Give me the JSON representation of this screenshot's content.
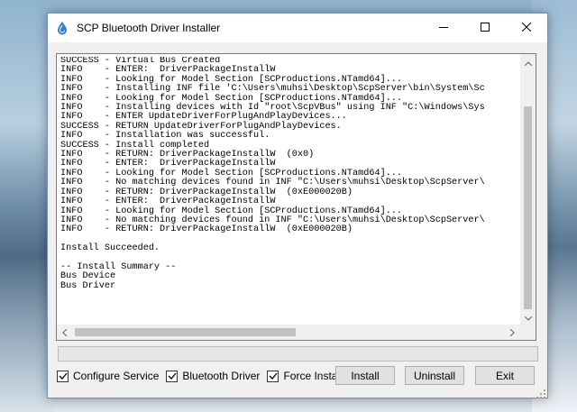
{
  "window": {
    "title": "SCP Bluetooth Driver Installer",
    "icon": "scp-app-icon"
  },
  "caption_buttons": [
    "minimize-icon",
    "maximize-icon",
    "close-icon"
  ],
  "log": {
    "lines": [
      "SUCCESS - Virtual Bus Created",
      "INFO    - ENTER:  DriverPackageInstallW",
      "INFO    - Looking for Model Section [SCProductions.NTamd64]...",
      "INFO    - Installing INF file 'C:\\Users\\muhsi\\Desktop\\ScpServer\\bin\\System\\Sc",
      "INFO    - Looking for Model Section [SCProductions.NTamd64]...",
      "INFO    - Installing devices with Id \"root\\ScpVBus\" using INF \"C:\\Windows\\Sys",
      "INFO    - ENTER UpdateDriverForPlugAndPlayDevices...",
      "SUCCESS - RETURN UpdateDriverForPlugAndPlayDevices.",
      "INFO    - Installation was successful.",
      "SUCCESS - Install completed",
      "INFO    - RETURN: DriverPackageInstallW  (0x0)",
      "INFO    - ENTER:  DriverPackageInstallW",
      "INFO    - Looking for Model Section [SCProductions.NTamd64]...",
      "INFO    - No matching devices found in INF \"C:\\Users\\muhsi\\Desktop\\ScpServer\\",
      "INFO    - RETURN: DriverPackageInstallW  (0xE000020B)",
      "INFO    - ENTER:  DriverPackageInstallW",
      "INFO    - Looking for Model Section [SCProductions.NTamd64]...",
      "INFO    - No matching devices found in INF \"C:\\Users\\muhsi\\Desktop\\ScpServer\\",
      "INFO    - RETURN: DriverPackageInstallW  (0xE000020B)",
      "",
      "Install Succeeded.",
      "",
      "-- Install Summary --",
      "Bus Device",
      "Bus Driver"
    ]
  },
  "progress": {
    "value": 0
  },
  "options": {
    "configure_service": {
      "label": "Configure Service",
      "checked": true
    },
    "bluetooth_driver": {
      "label": "Bluetooth Driver",
      "checked": true
    },
    "force_install": {
      "label": "Force Install",
      "checked": true
    }
  },
  "buttons": {
    "install": "Install",
    "uninstall": "Uninstall",
    "exit": "Exit"
  }
}
